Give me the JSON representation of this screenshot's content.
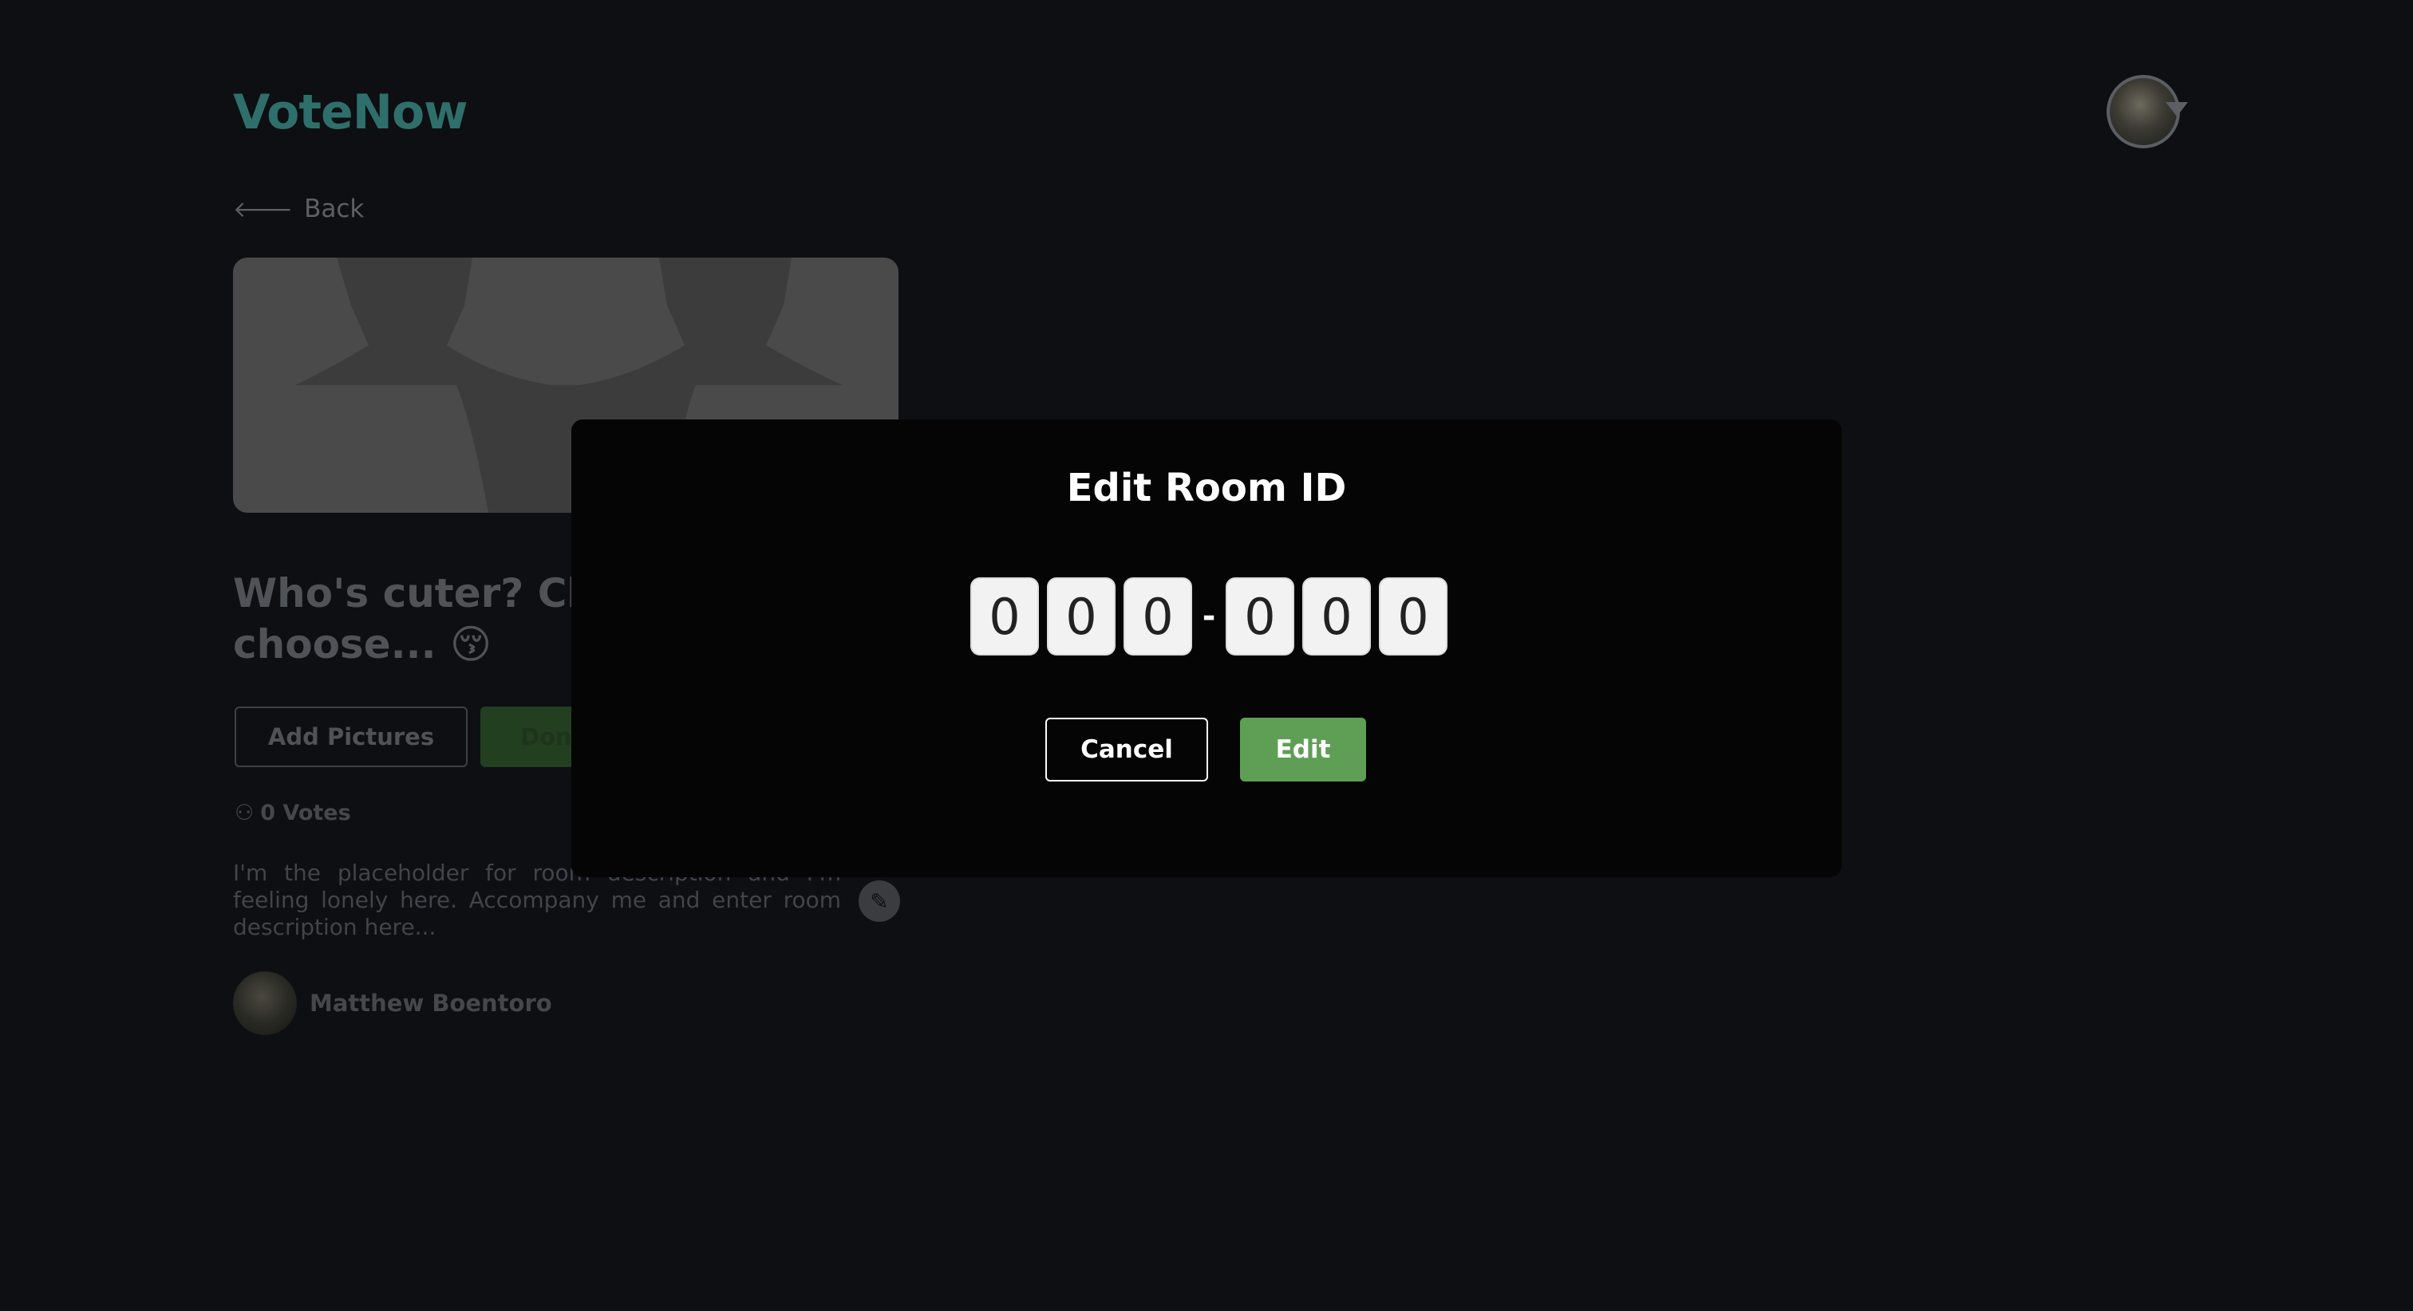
{
  "app": {
    "name": "VoteNow"
  },
  "header": {
    "avatar_icon": "user-avatar",
    "menu_icon": "caret-down-icon"
  },
  "nav": {
    "back_label": "Back",
    "back_icon": "arrow-left-icon"
  },
  "room": {
    "title": "Who's cuter? Click to choose... 😚",
    "add_pictures_label": "Add Pictures",
    "done_label": "Done",
    "votes_label": "0 Votes",
    "description": "I'm the placeholder for room description and I'm feeling lonely here. Accompany me and enter room description here...",
    "author_name": "Matthew Boentoro"
  },
  "modal": {
    "title": "Edit Room ID",
    "room_id_digits": [
      "0",
      "0",
      "0",
      "0",
      "0",
      "0"
    ],
    "separator": "-",
    "cancel_label": "Cancel",
    "edit_label": "Edit"
  },
  "colors": {
    "brand": "#2f6f6b",
    "modal_bg": "#050505",
    "edit_button": "#5f9f55",
    "page_bg": "#0d0f12"
  }
}
